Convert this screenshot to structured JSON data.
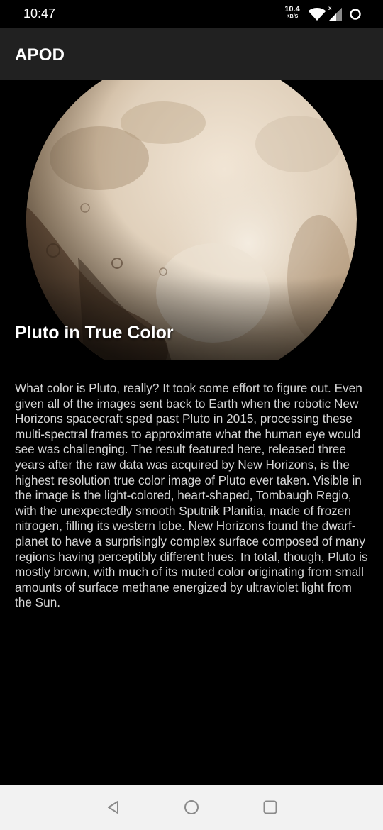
{
  "status_bar": {
    "time": "10:47",
    "net_speed_value": "10.4",
    "net_speed_unit": "KB/S",
    "icons": [
      "wifi-icon",
      "signal-icon",
      "loading-icon"
    ]
  },
  "app_bar": {
    "title": "APOD"
  },
  "apod": {
    "title": "Pluto in True Color",
    "explanation": "What color is Pluto, really? It took some effort to figure out. Even given all of the images sent back to Earth when the robotic New Horizons spacecraft sped past Pluto in 2015, processing these multi-spectral frames to approximate what the human eye would see was challenging. The result featured here, released three years after the raw data was acquired by New Horizons, is the highest resolution true color image of Pluto ever taken. Visible in the image is the light-colored, heart-shaped, Tombaugh Regio, with the unexpectedly smooth Sputnik Planitia, made of frozen nitrogen, filling its western lobe. New Horizons found the dwarf-planet to have a surprisingly complex surface composed of many regions having perceptibly different hues.  In total, though, Pluto is mostly brown, with much of its muted color originating from small amounts of surface methane energized by ultraviolet light from the Sun."
  },
  "nav_bar": {
    "buttons": [
      "back-icon",
      "home-icon",
      "recents-icon"
    ]
  },
  "colors": {
    "app_bar": "#212121",
    "background": "#000000",
    "body_text": "#d6d6d6",
    "nav_bar": "#f2f2f2"
  }
}
